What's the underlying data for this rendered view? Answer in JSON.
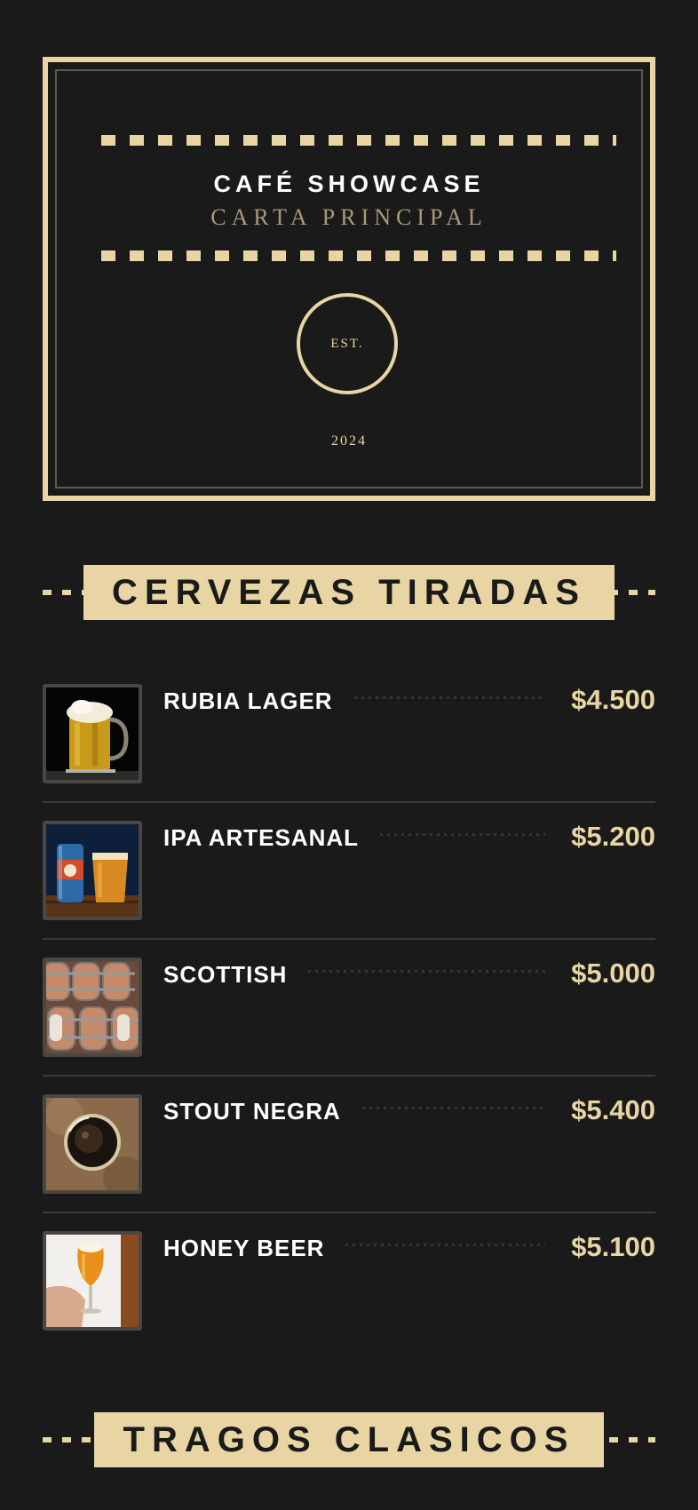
{
  "header": {
    "title": "CAFÉ SHOWCASE",
    "subtitle": "CARTA PRINCIPAL",
    "est_label": "EST.",
    "est_year": "2024"
  },
  "sections": [
    {
      "title": "CERVEZAS TIRADAS",
      "items": [
        {
          "name": "RUBIA LAGER",
          "price": "$4.500",
          "image": "lager-mug-photo"
        },
        {
          "name": "IPA ARTESANAL",
          "price": "$5.200",
          "image": "ipa-can-and-glass-photo"
        },
        {
          "name": "SCOTTISH",
          "price": "$5.000",
          "image": "beer-barrels-photo"
        },
        {
          "name": "STOUT NEGRA",
          "price": "$5.400",
          "image": "stout-glass-top-view-photo"
        },
        {
          "name": "HONEY BEER",
          "price": "$5.100",
          "image": "honey-beer-glass-in-hand-photo"
        }
      ]
    },
    {
      "title": "TRAGOS CLASICOS",
      "items": []
    }
  ],
  "colors": {
    "background": "#1a1a1a",
    "accent": "#e8d5a3",
    "muted_gold": "#a89a78",
    "text": "#ffffff"
  }
}
